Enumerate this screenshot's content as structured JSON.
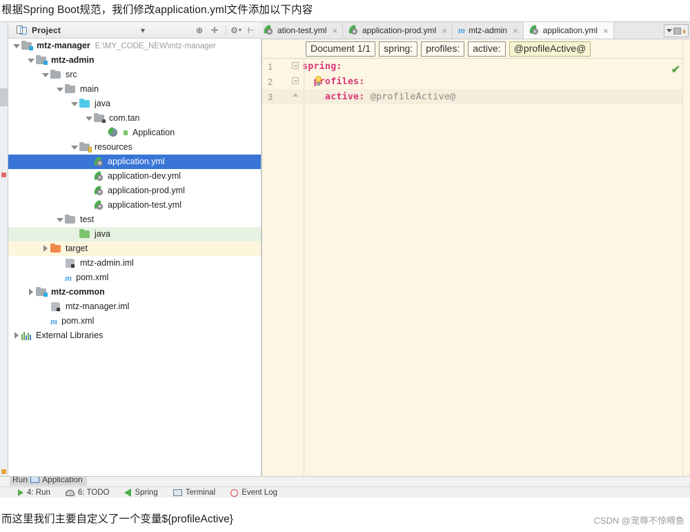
{
  "caption_top": "根据Spring Boot规范，我们修改application.yml文件添加以下内容",
  "caption_bottom": "而这里我们主要自定义了一个变量${profileActive}",
  "watermark": "CSDN @宠辱不惊嘚鱼",
  "panel": {
    "title": "Project",
    "icons": [
      {
        "name": "collapse-all-icon",
        "glyph": "✛"
      },
      {
        "name": "target-icon",
        "glyph": "⊕"
      },
      {
        "name": "settings-icon",
        "glyph": "⚙"
      },
      {
        "name": "hide-icon",
        "glyph": "⊢"
      },
      {
        "name": "chevron-down-icon",
        "glyph": "▾"
      }
    ]
  },
  "tabs": [
    {
      "label": "ation-test.yml",
      "icon": "yml",
      "active": false,
      "clipped": true
    },
    {
      "label": "application-prod.yml",
      "icon": "yml",
      "active": false,
      "clipped": false
    },
    {
      "label": "mtz-admin",
      "icon": "maven",
      "active": false,
      "clipped": false
    },
    {
      "label": "application.yml",
      "icon": "yml",
      "active": true,
      "clipped": false
    }
  ],
  "tabs_right_badge": "s",
  "tree": [
    {
      "label": "mtz-manager",
      "suffix": "E:\\MY_CODE_NEW\\mtz-manager",
      "indent": 0,
      "arrow": "down",
      "icon": "module-folder",
      "bold": true,
      "state": "normal"
    },
    {
      "label": "mtz-admin",
      "suffix": "",
      "indent": 1,
      "arrow": "down",
      "icon": "module-folder",
      "bold": true,
      "state": "normal"
    },
    {
      "label": "src",
      "suffix": "",
      "indent": 2,
      "arrow": "down",
      "icon": "folder-gray",
      "bold": false,
      "state": "normal"
    },
    {
      "label": "main",
      "suffix": "",
      "indent": 3,
      "arrow": "down",
      "icon": "folder-gray",
      "bold": false,
      "state": "normal"
    },
    {
      "label": "java",
      "suffix": "",
      "indent": 4,
      "arrow": "down",
      "icon": "folder-cyan",
      "bold": false,
      "state": "normal"
    },
    {
      "label": "com.tan",
      "suffix": "",
      "indent": 5,
      "arrow": "down",
      "icon": "folder-package",
      "bold": false,
      "state": "normal"
    },
    {
      "label": "Application",
      "suffix": "",
      "indent": 6,
      "arrow": "none",
      "icon": "spring-class",
      "bold": false,
      "state": "normal"
    },
    {
      "label": "resources",
      "suffix": "",
      "indent": 4,
      "arrow": "down",
      "icon": "folder-resources",
      "bold": false,
      "state": "normal"
    },
    {
      "label": "application.yml",
      "suffix": "",
      "indent": 5,
      "arrow": "none",
      "icon": "yml",
      "bold": false,
      "state": "selected"
    },
    {
      "label": "application-dev.yml",
      "suffix": "",
      "indent": 5,
      "arrow": "none",
      "icon": "yml",
      "bold": false,
      "state": "normal"
    },
    {
      "label": "application-prod.yml",
      "suffix": "",
      "indent": 5,
      "arrow": "none",
      "icon": "yml",
      "bold": false,
      "state": "normal"
    },
    {
      "label": "application-test.yml",
      "suffix": "",
      "indent": 5,
      "arrow": "none",
      "icon": "yml",
      "bold": false,
      "state": "normal"
    },
    {
      "label": "test",
      "suffix": "",
      "indent": 3,
      "arrow": "down",
      "icon": "folder-gray",
      "bold": false,
      "state": "normal"
    },
    {
      "label": "java",
      "suffix": "",
      "indent": 4,
      "arrow": "none",
      "icon": "folder-green",
      "bold": false,
      "state": "green"
    },
    {
      "label": "target",
      "suffix": "",
      "indent": 2,
      "arrow": "right",
      "icon": "folder-orange",
      "bold": false,
      "state": "yellow"
    },
    {
      "label": "mtz-admin.iml",
      "suffix": "",
      "indent": 3,
      "arrow": "none",
      "icon": "iml",
      "bold": false,
      "state": "normal"
    },
    {
      "label": "pom.xml",
      "suffix": "",
      "indent": 3,
      "arrow": "none",
      "icon": "maven",
      "bold": false,
      "state": "normal"
    },
    {
      "label": "mtz-common",
      "suffix": "",
      "indent": 1,
      "arrow": "right",
      "icon": "module-folder",
      "bold": true,
      "state": "normal"
    },
    {
      "label": "mtz-manager.iml",
      "suffix": "",
      "indent": 2,
      "arrow": "none",
      "icon": "iml",
      "bold": false,
      "state": "normal"
    },
    {
      "label": "pom.xml",
      "suffix": "",
      "indent": 2,
      "arrow": "none",
      "icon": "maven",
      "bold": false,
      "state": "normal"
    },
    {
      "label": "External Libraries",
      "suffix": "",
      "indent": 0,
      "arrow": "right",
      "icon": "libraries",
      "bold": false,
      "state": "normal"
    }
  ],
  "editor": {
    "breadcrumbs": [
      {
        "label": "Document 1/1",
        "highlight": false
      },
      {
        "label": "spring:",
        "highlight": false
      },
      {
        "label": "profiles:",
        "highlight": false
      },
      {
        "label": "active:",
        "highlight": false
      },
      {
        "label": "@profileActive@",
        "highlight": true
      }
    ],
    "lines": [
      {
        "no": "1",
        "indent": 0,
        "key": "spring:",
        "value": "",
        "fold": "start",
        "current": false,
        "bulb": false
      },
      {
        "no": "2",
        "indent": 1,
        "key": "profiles:",
        "value": "",
        "fold": "start",
        "current": false,
        "bulb": true
      },
      {
        "no": "3",
        "indent": 2,
        "key": "active:",
        "value": " @profileActive@",
        "fold": "end",
        "current": true,
        "bulb": false
      }
    ],
    "inspection_status": "✔"
  },
  "runbar": {
    "title": "Application",
    "run_word": "Run",
    "items": [
      {
        "label": "4: Run",
        "icon": "run-icon"
      },
      {
        "label": "6: TODO",
        "icon": "todo-icon"
      },
      {
        "label": "Spring",
        "icon": "spring-icon"
      },
      {
        "label": "Terminal",
        "icon": "terminal-icon"
      },
      {
        "label": "Event Log",
        "icon": "event-log-icon"
      }
    ]
  }
}
